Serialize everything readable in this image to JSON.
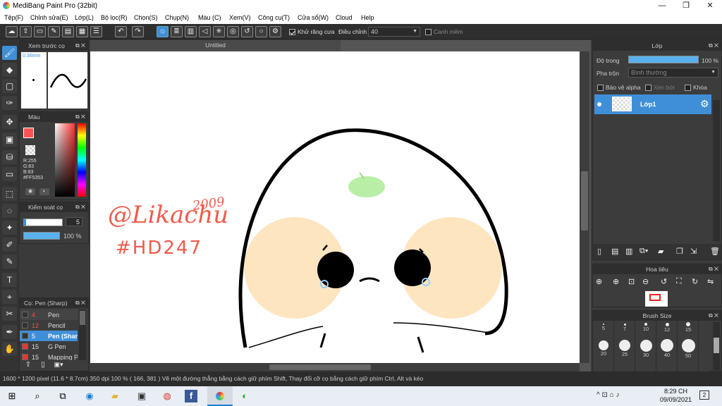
{
  "window": {
    "title": "MediBang Paint Pro (32bit)",
    "min": "—",
    "max": "❐",
    "close": "✕"
  },
  "menu": [
    "Tệp(F)",
    "Chỉnh sửa(E)",
    "Lớp(L)",
    "Bộ lọc(R)",
    "Chọn(S)",
    "Chụp(N)",
    "Màu (C)",
    "Xem(V)",
    "Công cụ(T)",
    "Cửa sổ(W)",
    "Cloud",
    "Help"
  ],
  "toolbar": {
    "antialias_label": "Khử răng cưa",
    "correction_label": "Điều chỉnh",
    "correction_value": "40",
    "edge_label": "Canh mềm"
  },
  "brush_preview": {
    "title": "Xem trước cọ",
    "size": "0.36mm"
  },
  "color": {
    "title": "Màu",
    "r": "R:255",
    "g": "G:83",
    "b": "B:83",
    "hex": "#FF5353",
    "primary": "#FF5353"
  },
  "brush_control": {
    "title": "Kiểm soát cọ",
    "size_value": "5",
    "opacity_value": "100 %"
  },
  "brush_list": {
    "title": "Cọ: Pen (Sharp)",
    "items": [
      {
        "num": "4",
        "name": "Pen",
        "color": "#333333"
      },
      {
        "num": "12",
        "name": "Pencil",
        "color": "#333333"
      },
      {
        "num": "5",
        "name": "Pen (Sharp)",
        "color": "#333333"
      },
      {
        "num": "15",
        "name": "G Pen",
        "color": "#ee3333"
      },
      {
        "num": "15",
        "name": "Mapping P",
        "color": "#ee3333"
      }
    ]
  },
  "canvas": {
    "tab": "Untitled",
    "signature": "@Likachu",
    "year": "2009",
    "tag": "#HD247"
  },
  "layer_panel": {
    "title": "Lớp",
    "opacity_label": "Độ trong",
    "opacity_value": "100 %",
    "blend_label": "Pha trộn",
    "blend_value": "Bình thường",
    "protect_alpha": "Bảo vệ alpha",
    "clip": "Xén bớt",
    "lock": "Khóa",
    "layer_name": "Lớp1"
  },
  "navigator": {
    "title": "Hoa tiêu"
  },
  "brush_size": {
    "title": "Brush Size",
    "row1": [
      "5",
      "7",
      "10",
      "12",
      "15"
    ],
    "row2": [
      "20",
      "25",
      "30",
      "40",
      "50"
    ]
  },
  "status": {
    "text": "1600 * 1200 pixel   (11.6 * 8.7cm)   350 dpi   100 %   ( 166, 381 )   Vẽ một đường thẳng bằng cách giữ phím Shift, Thay đổi cỡ cọ bằng cách giữ phím Ctrl, Alt và kéo"
  },
  "taskbar": {
    "time": "8:29 CH",
    "date": "09/09/2021",
    "notifications": "2",
    "tray": "^ ⊡ ⌂ ♪"
  }
}
